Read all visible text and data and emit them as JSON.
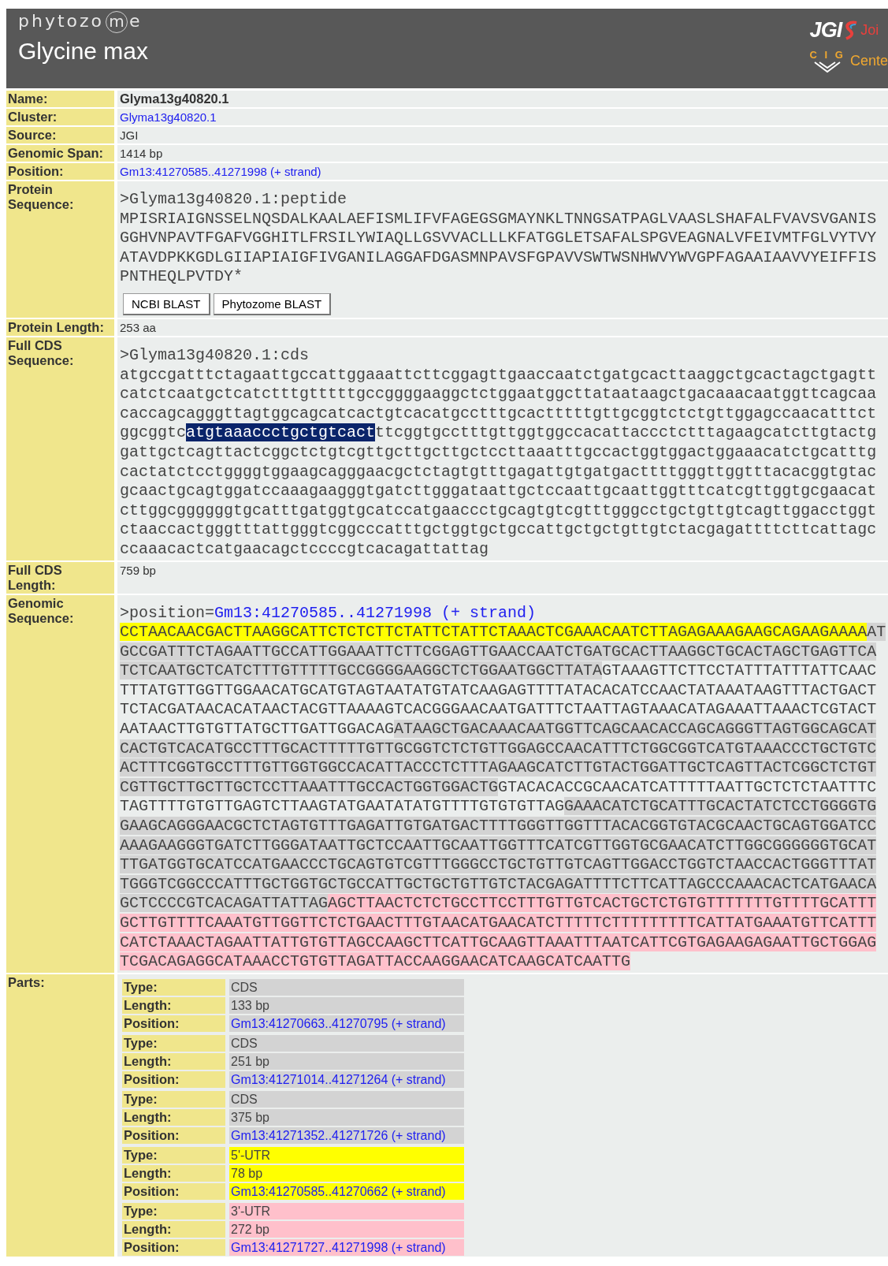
{
  "header": {
    "logo": {
      "text_before": "phytozo",
      "circled": "m",
      "text_after": "e"
    },
    "title": "Glycine max",
    "partner_logos": [
      {
        "mark": "JGI",
        "text": "Joi"
      },
      {
        "mark": "C I G",
        "text": "Cente"
      }
    ]
  },
  "fields": [
    {
      "label": "Name:",
      "kind": "bold",
      "value": "Glyma13g40820.1"
    },
    {
      "label": "Cluster:",
      "kind": "link",
      "value": "Glyma13g40820.1"
    },
    {
      "label": "Source:",
      "kind": "text",
      "value": "JGI"
    },
    {
      "label": "Genomic Span:",
      "kind": "text",
      "value": "1414 bp"
    },
    {
      "label": "Position:",
      "kind": "link",
      "value": "Gm13:41270585..41271998 (+ strand)"
    },
    {
      "label": "Protein Sequence:",
      "kind": "protein",
      "header": ">Glyma13g40820.1:peptide",
      "lines": [
        "MPISRIAIGNSSELNQSDALKAALAEFISMLIFVFAGEGSGMAYNKLTNNGSATPAGLVAASLSHAFALFVAVSVGANIS",
        "GGHVNPAVTFGAFVGGHITLFRSILYWIAQLLGSVVACLLLKFATGGLETSAFALSPGVEAGNALVFEIVMTFGLVYTVY",
        "ATAVDPKKGDLGIIAPIAIGFIVGANILAGGAFDGASMNPAVSFGPAVVSWTWSNHWVYWVGPFAGAAIAAVVYEIFFIS",
        "PNTHEQLPVTDY*"
      ],
      "buttons": [
        "NCBI BLAST",
        "Phytozome BLAST"
      ]
    },
    {
      "label": "Protein Length:",
      "kind": "text",
      "value": "253 aa"
    },
    {
      "label": "Full CDS Sequence:",
      "kind": "cds",
      "header": ">Glyma13g40820.1:cds",
      "lines": [
        [
          {
            "text": "atgccgatttctagaattgccattggaaattcttcggagttgaaccaatctgatgcacttaaggctgcactagctgagtt",
            "selected": false
          }
        ],
        [
          {
            "text": "catctcaatgctcatctttgtttttgccggggaaggctctggaatggcttataataagctgacaaacaatggttcagcaa",
            "selected": false
          }
        ],
        [
          {
            "text": "caccagcagggttagtggcagcatcactgtcacatgcctttgcactttttgttgcggtctctgttggagccaacatttct",
            "selected": false
          }
        ],
        [
          {
            "text": "ggcggtc",
            "selected": false
          },
          {
            "text": "atgtaaaccctgctgtcact",
            "selected": true
          },
          {
            "text": "ttcggtgcctttgttggtggccacattaccctctttagaagcatcttgtactg",
            "selected": false
          }
        ],
        [
          {
            "text": "gattgctcagttactcggctctgtcgttgcttgcttgctccttaaatttgccactggtggactggaaacatctgcatttg",
            "selected": false
          }
        ],
        [
          {
            "text": "cactatctcctggggtggaagcagggaacgctctagtgtttgagattgtgatgacttttgggttggtttacacggtgtac",
            "selected": false
          }
        ],
        [
          {
            "text": "gcaactgcagtggatccaaagaagggtgatcttgggataattgctccaattgcaattggtttcatcgttggtgcgaacat",
            "selected": false
          }
        ],
        [
          {
            "text": "cttggcggggggtgcatttgatggtgcatccatgaaccctgcagtgtcgtttgggcctgctgttgtcagttggacctggt",
            "selected": false
          }
        ],
        [
          {
            "text": "ctaaccactgggtttattgggtcggcccatttgctggtgctgccattgctgctgttgtctacgagattttcttcattagc",
            "selected": false
          }
        ],
        [
          {
            "text": "ccaaacactcatgaacagctccccgtcacagattattag",
            "selected": false
          }
        ]
      ]
    },
    {
      "label": "Full CDS Length:",
      "kind": "text",
      "value": "759 bp"
    },
    {
      "label": "Genomic Sequence:",
      "kind": "genomic",
      "header_prefix": ">position=",
      "header_link": "Gm13:41270585..41271998 (+ strand)",
      "lines": [
        [
          {
            "kind": "utr5",
            "text": "CCTAACAACGACTTAAGGCATTCTCTCTTCTATTCTATTCTAAACTCGAAACAATCTTAGAGAAAGAAGCAGAAGAAAA"
          },
          {
            "kind": "cds",
            "text": "AT"
          }
        ],
        [
          {
            "kind": "cds",
            "text": "GCCGATTTCTAGAATTGCCATTGGAAATTCTTCGGAGTTGAACCAATCTGATGCACTTAAGGCTGCACTAGCTGAGTTCA"
          }
        ],
        [
          {
            "kind": "cds",
            "text": "TCTCAATGCTCATCTTTGTTTTTGCCGGGGAAGGCTCTGGAATGGCTTATA"
          },
          {
            "kind": "intron",
            "text": "GTAAAGTTCTTCCTATTTATTTATTCAAC"
          }
        ],
        [
          {
            "kind": "intron",
            "text": "TTTATGTTGGTTGGAACATGCATGTAGTAATATGTATCAAGAGTTTTATACACATCCAACTATAAATAAGTTTACTGACT"
          }
        ],
        [
          {
            "kind": "intron",
            "text": "TCTACGATAACACATAACTACGTTAAAAGTCACGGGAACAATGATTTCTAATTAGTAAACATAGAAATTAAACTCGTACT"
          }
        ],
        [
          {
            "kind": "intron",
            "text": "AATAACTTGTGTTATGCTTGATTGGACAG"
          },
          {
            "kind": "cds",
            "text": "ATAAGCTGACAAACAATGGTTCAGCAACACCAGCAGGGTTAGTGGCAGCAT"
          }
        ],
        [
          {
            "kind": "cds",
            "text": "CACTGTCACATGCCTTTGCACTTTTTGTTGCGGTCTCTGTTGGAGCCAACATTTCTGGCGGTCATGTAAACCCTGCTGTC"
          }
        ],
        [
          {
            "kind": "cds",
            "text": "ACTTTCGGTGCCTTTGTTGGTGGCCACATTACCCTCTTTAGAAGCATCTTGTACTGGATTGCTCAGTTACTCGGCTCTGT"
          }
        ],
        [
          {
            "kind": "cds",
            "text": "CGTTGCTTGCTTGCTCCTTAAATTTGCCACTGGTGGACTG"
          },
          {
            "kind": "intron",
            "text": "GTACACACCGCAACATCATTTTTAATTGCTCTCTAATTTC"
          }
        ],
        [
          {
            "kind": "intron",
            "text": "TAGTTTTGTGTTGAGTCTTAAGTATGAATATATGTTTTGTGTGTTAG"
          },
          {
            "kind": "cds",
            "text": "GAAACATCTGCATTTGCACTATCTCCTGGGGTG"
          }
        ],
        [
          {
            "kind": "cds",
            "text": "GAAGCAGGGAACGCTCTAGTGTTTGAGATTGTGATGACTTTTGGGTTGGTTTACACGGTGTACGCAACTGCAGTGGATCC"
          }
        ],
        [
          {
            "kind": "cds",
            "text": "AAAGAAGGGTGATCTTGGGATAATTGCTCCAATTGCAATTGGTTTCATCGTTGGTGCGAACATCTTGGCGGGGGGTGCAT"
          }
        ],
        [
          {
            "kind": "cds",
            "text": "TTGATGGTGCATCCATGAACCCTGCAGTGTCGTTTGGGCCTGCTGTTGTCAGTTGGACCTGGTCTAACCACTGGGTTTAT"
          }
        ],
        [
          {
            "kind": "cds",
            "text": "TGGGTCGGCCCATTTGCTGGTGCTGCCATTGCTGCTGTTGTCTACGAGATTTTCTTCATTAGCCCAAACACTCATGAACA"
          }
        ],
        [
          {
            "kind": "cds",
            "text": "GCTCCCCGTCACAGATTATTAG"
          },
          {
            "kind": "utr3",
            "text": "AGCTTAACTCTCTGCCTTCCTTTGTTGTCACTGCTCTGTGTTTTTTTGTTTTGCATTT"
          }
        ],
        [
          {
            "kind": "utr3",
            "text": "GCTTGTTTTCAAATGTTGGTTCTCTGAACTTTGTAACATGAACATCTTTTTCTTTTTTTTTCATTATGAAATGTTCATTT"
          }
        ],
        [
          {
            "kind": "utr3",
            "text": "CATCTAAACTAGAATTATTGTGTTAGCCAAGCTTCATTGCAAGTTAAATTTAATCATTCGTGAGAAGAGAATTGCTGGAG"
          }
        ],
        [
          {
            "kind": "utr3",
            "text": "TCGACAGAGGCATAAACCTGTGTTAGATTACCAAGGAACATCAAGCATCAATTG"
          }
        ]
      ]
    },
    {
      "label": "Parts:",
      "kind": "parts",
      "parts": [
        {
          "kind": "cds",
          "rows": [
            {
              "label": "Type:",
              "value": "CDS",
              "link": false
            },
            {
              "label": "Length:",
              "value": "133 bp",
              "link": false
            },
            {
              "label": "Position:",
              "value": "Gm13:41270663..41270795 (+ strand)",
              "link": true
            }
          ]
        },
        {
          "kind": "cds",
          "rows": [
            {
              "label": "Type:",
              "value": "CDS",
              "link": false
            },
            {
              "label": "Length:",
              "value": "251 bp",
              "link": false
            },
            {
              "label": "Position:",
              "value": "Gm13:41271014..41271264 (+ strand)",
              "link": true
            }
          ]
        },
        {
          "kind": "cds",
          "rows": [
            {
              "label": "Type:",
              "value": "CDS",
              "link": false
            },
            {
              "label": "Length:",
              "value": "375 bp",
              "link": false
            },
            {
              "label": "Position:",
              "value": "Gm13:41271352..41271726 (+ strand)",
              "link": true
            }
          ]
        },
        {
          "kind": "utr5",
          "rows": [
            {
              "label": "Type:",
              "value": "5'-UTR",
              "link": false
            },
            {
              "label": "Length:",
              "value": "78 bp",
              "link": false
            },
            {
              "label": "Position:",
              "value": "Gm13:41270585..41270662 (+ strand)",
              "link": true
            }
          ]
        },
        {
          "kind": "utr3",
          "rows": [
            {
              "label": "Type:",
              "value": "3'-UTR",
              "link": false
            },
            {
              "label": "Length:",
              "value": "272 bp",
              "link": false
            },
            {
              "label": "Position:",
              "value": "Gm13:41271727..41271998 (+ strand)",
              "link": true
            }
          ]
        }
      ]
    }
  ]
}
